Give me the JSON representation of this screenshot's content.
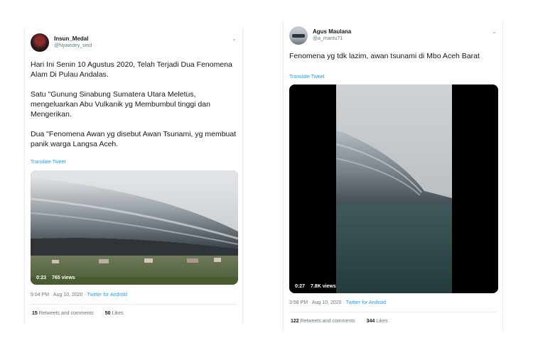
{
  "tweets": [
    {
      "name": "Insun_Medal",
      "handle": "@Nyaiedey_smd",
      "paragraphs": [
        "Hari Ini Senin 10 Agustus 2020, Telah Terjadi Dua Fenomena Alam Di Pulau Andalas.",
        "Satu \"Gunung Sinabung Sumatera Utara Meletus, mengeluarkan Abu Vulkanik yg Membumbul tinggi dan Mengerikan.",
        "Dua \"Fenomena Awan yg disebut Awan Tsunami, yg membuat panik warga Langsa Aceh."
      ],
      "translate": "Translate Tweet",
      "video_time": "0:23",
      "video_views": "765 views",
      "timestamp": "9:04 PM · Aug 10, 2020 · ",
      "source": "Twitter for Android",
      "retweets_count": "15",
      "retweets_label": "Retweets and comments",
      "likes_count": "50",
      "likes_label": "Likes"
    },
    {
      "name": "Agus Maulana",
      "handle": "@a_mantu71",
      "paragraphs": [
        "Fenomena yg tdk lazim, awan tsunami di Mbo Aceh Barat"
      ],
      "translate": "Translate Tweet",
      "video_time": "0:27",
      "video_views": "7.8K views",
      "timestamp": "3:58 PM · Aug 10, 2020 · ",
      "source": "Twitter for Android",
      "retweets_count": "122",
      "retweets_label": "Retweets and comments",
      "likes_count": "344",
      "likes_label": "Likes"
    }
  ],
  "icons": {
    "caret": "chevron-down-icon"
  }
}
